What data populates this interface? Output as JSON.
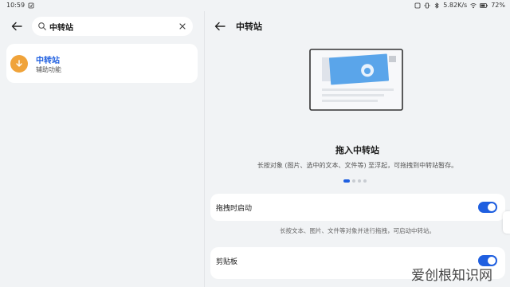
{
  "status_bar": {
    "time": "10:59",
    "net_speed": "5.82K/s",
    "battery": "72%"
  },
  "search": {
    "query": "中转站",
    "placeholder": ""
  },
  "results": [
    {
      "title": "中转站",
      "subtitle": "辅助功能",
      "icon": "transfer-station-icon"
    }
  ],
  "detail": {
    "title": "中转站",
    "feature_title": "拖入中转站",
    "feature_desc": "长按对象 (图片、选中的文本、文件等) 至浮起，可拖拽到中转站暂存。",
    "page_indicator": {
      "count": 4,
      "active": 0
    }
  },
  "settings": [
    {
      "label": "拖拽时启动",
      "enabled": true,
      "note": "长按文本、图片、文件等对象并进行拖拽，可启动中转站。"
    },
    {
      "label": "剪贴板",
      "enabled": true
    }
  ],
  "watermark": "爱创根知识网",
  "colors": {
    "accent": "#1f5fe0",
    "icon_orange": "#f0a33a",
    "background": "#f1f3f5",
    "card": "#ffffff"
  }
}
